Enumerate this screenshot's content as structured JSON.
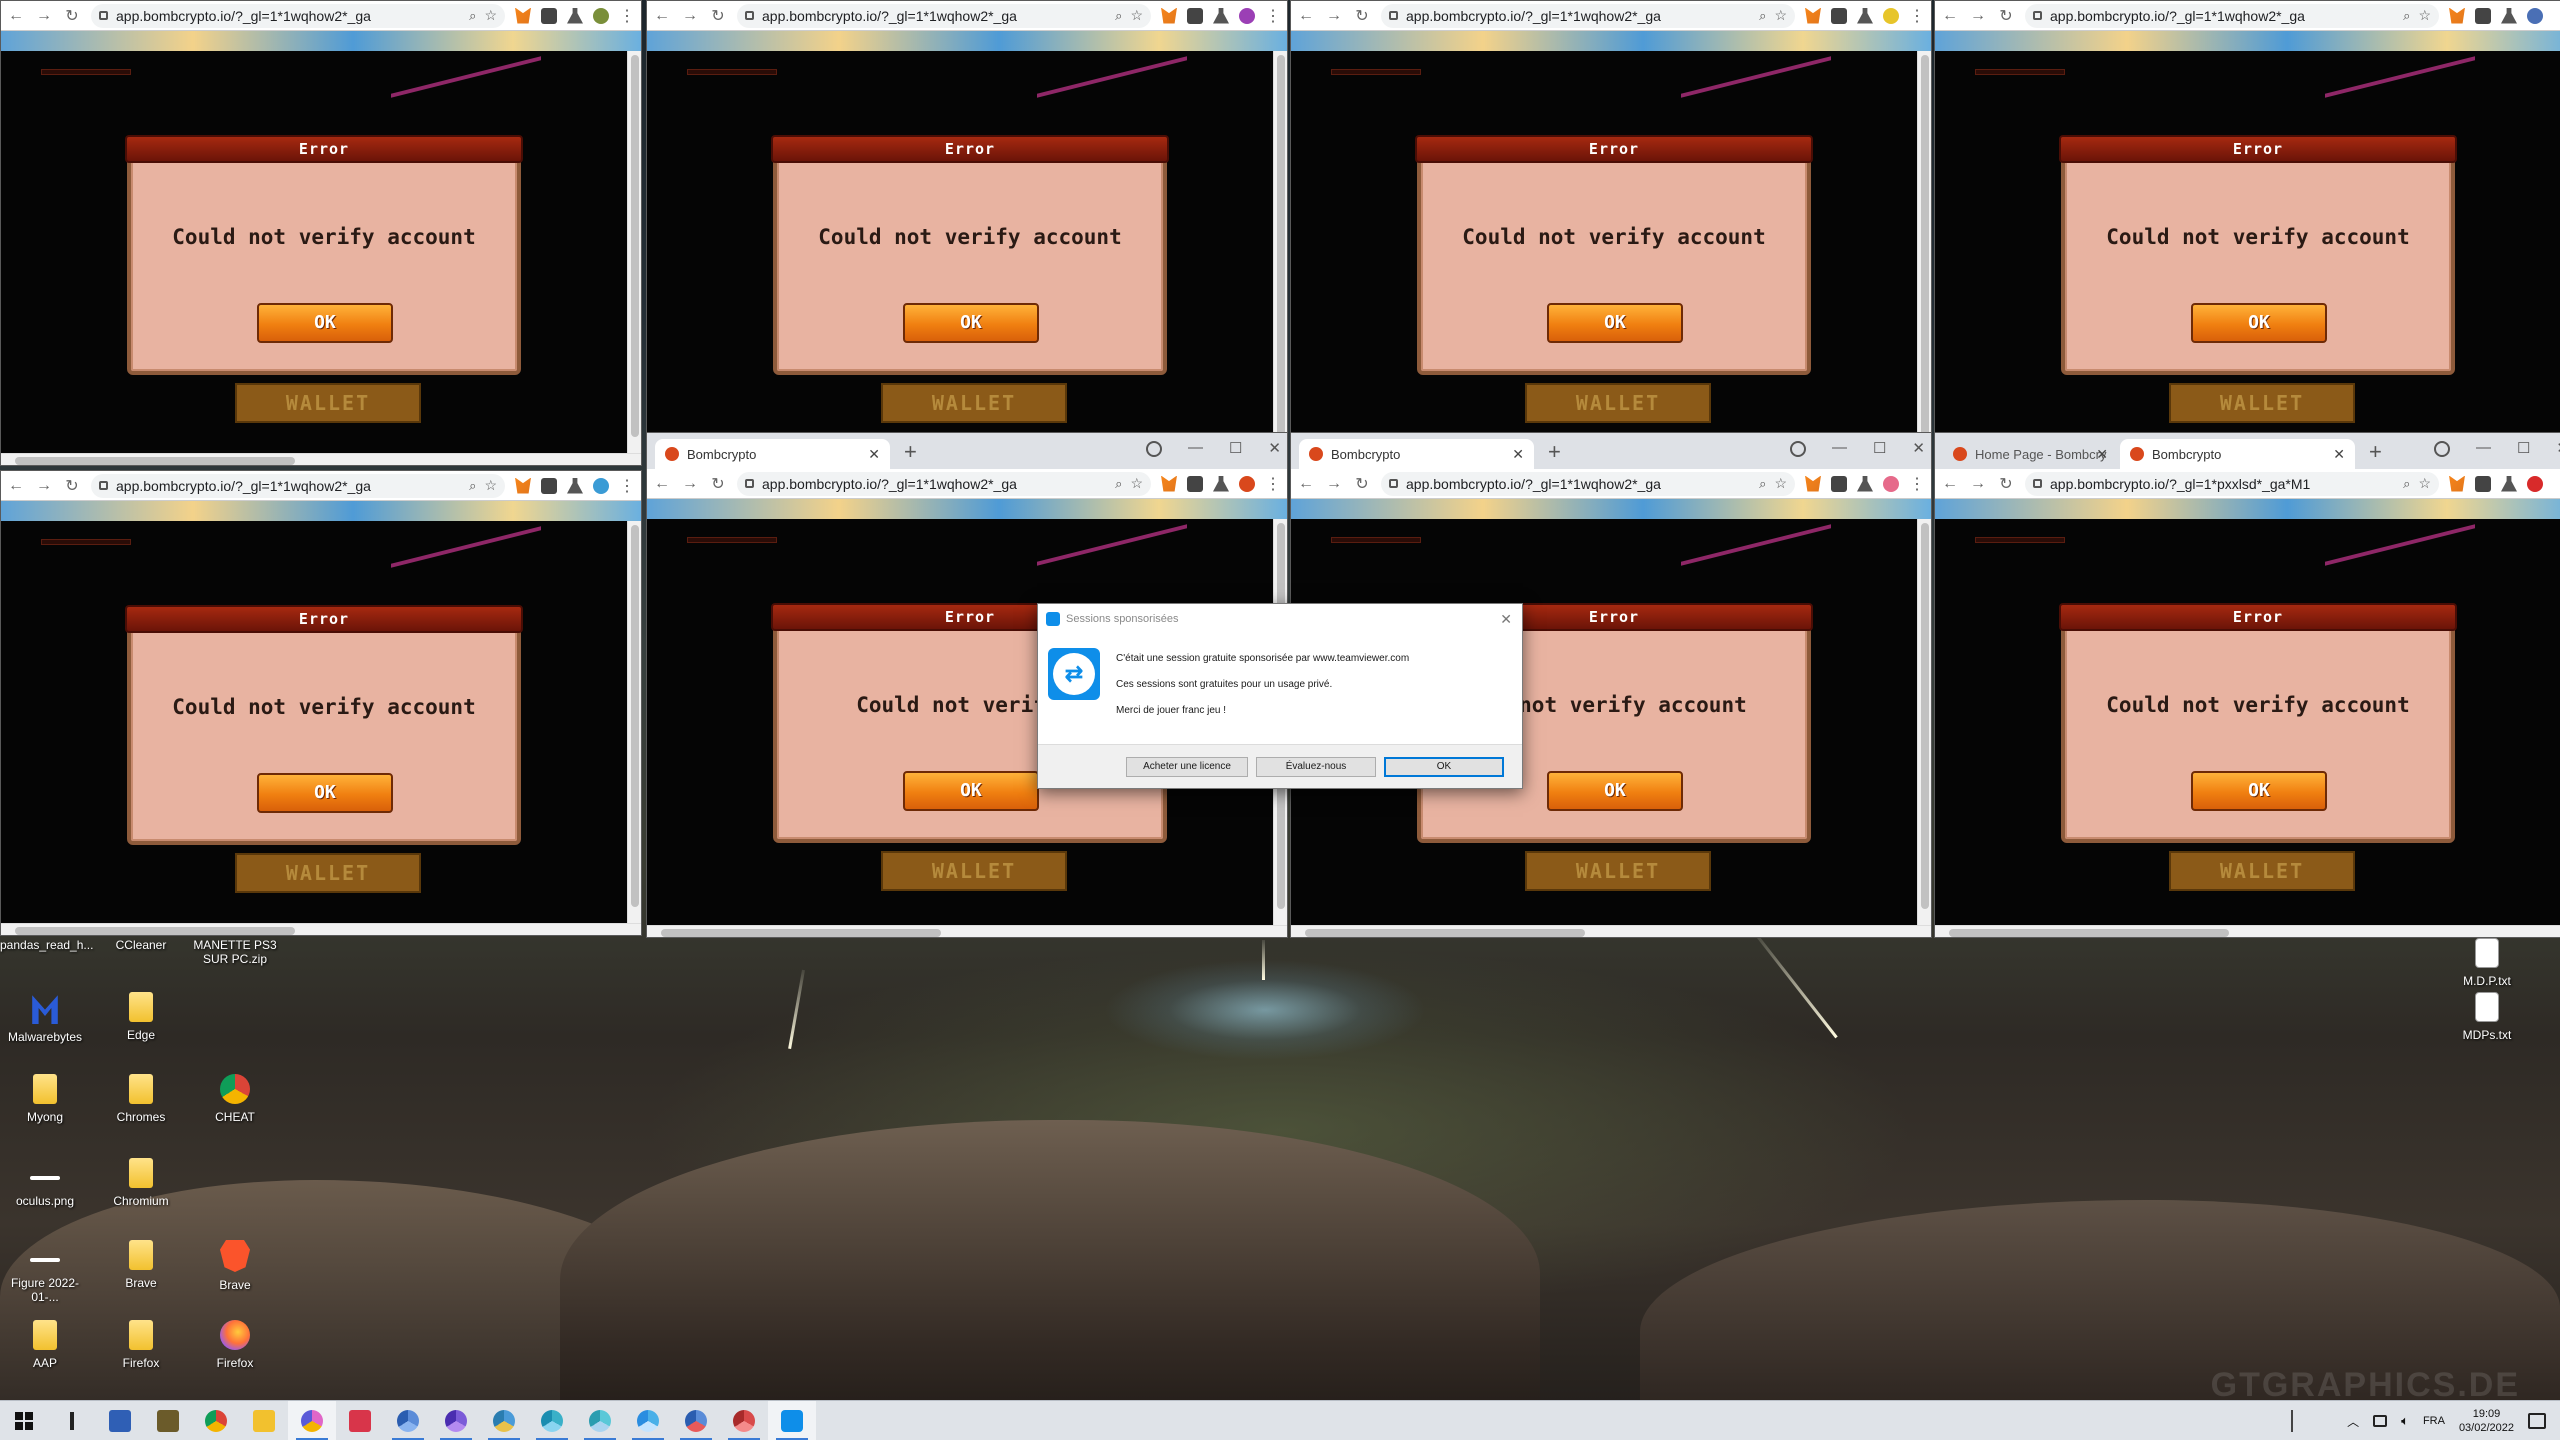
{
  "windows": [
    {
      "id": "w1",
      "url": "app.bombcrypto.io/?_gl=1*1wqhow2*_ga",
      "has_tabs": false,
      "title": "Error",
      "message": "Could not verify account",
      "ok": "OK",
      "wallet": "WALLET",
      "avatar_color": "#7a8f3a"
    },
    {
      "id": "w2",
      "url": "app.bombcrypto.io/?_gl=1*1wqhow2*_ga",
      "has_tabs": false,
      "title": "Error",
      "message": "Could not verify account",
      "ok": "OK",
      "wallet": "WALLET",
      "avatar_color": "#9b3fb5"
    },
    {
      "id": "w3",
      "url": "app.bombcrypto.io/?_gl=1*1wqhow2*_ga",
      "has_tabs": false,
      "title": "Error",
      "message": "Could not verify account",
      "ok": "OK",
      "wallet": "WALLET",
      "avatar_color": "#e7c52a"
    },
    {
      "id": "w4",
      "url": "app.bombcrypto.io/?_gl=1*1wqhow2*_ga",
      "has_tabs": false,
      "title": "Error",
      "message": "Could not verify account",
      "ok": "OK",
      "wallet": "WALLET",
      "avatar_color": "#4a6fb5"
    },
    {
      "id": "w5",
      "url": "app.bombcrypto.io/?_gl=1*1wqhow2*_ga",
      "has_tabs": false,
      "title": "Error",
      "message": "Could not verify account",
      "ok": "OK",
      "wallet": "WALLET",
      "avatar_color": "#3a9bd5"
    },
    {
      "id": "w6",
      "url": "app.bombcrypto.io/?_gl=1*1wqhow2*_ga",
      "has_tabs": true,
      "tabs": [
        "Bombcrypto"
      ],
      "title": "Error",
      "message": "Could not verify a",
      "ok": "OK",
      "wallet": "WALLET",
      "avatar_color": "#d9481c"
    },
    {
      "id": "w7",
      "url": "app.bombcrypto.io/?_gl=1*1wqhow2*_ga",
      "has_tabs": true,
      "tabs": [
        "Bombcrypto"
      ],
      "title": "Error",
      "message": "ld not verify account",
      "ok": "OK",
      "wallet": "WALLET",
      "avatar_color": "#e66a8a"
    },
    {
      "id": "w8",
      "url": "app.bombcrypto.io/?_gl=1*pxxlsd*_ga*M1",
      "has_tabs": true,
      "tabs": [
        "Home Page - Bombcry",
        "Bombcrypto"
      ],
      "title": "Error",
      "message": "Could not verify account",
      "ok": "OK",
      "wallet": "WALLET",
      "avatar_color": "#d82a2a"
    }
  ],
  "teamviewer": {
    "title": "Sessions sponsorisées",
    "line1": "C'était une session gratuite sponsorisée par www.teamviewer.com",
    "line2": "Ces sessions sont gratuites pour un usage privé.",
    "line3": "Merci de jouer franc jeu !",
    "btn_license": "Acheter une licence",
    "btn_rate": "Évaluez-nous",
    "btn_ok": "OK"
  },
  "desktop_icons": [
    {
      "label": "pandas_read_h...",
      "icon": "file-icon"
    },
    {
      "label": "CCleaner",
      "icon": "ccleaner-icon"
    },
    {
      "label": "MANETTE PS3 SUR PC.zip",
      "icon": "zip-icon"
    },
    {
      "label": "Malwarebytes",
      "icon": "malwarebytes-icon"
    },
    {
      "label": "Edge",
      "icon": "folder-icon"
    },
    {
      "label": "Myong",
      "icon": "folder-icon"
    },
    {
      "label": "Chromes",
      "icon": "folder-icon"
    },
    {
      "label": "CHEAT",
      "icon": "chrome-icon"
    },
    {
      "label": "oculus.png",
      "icon": "image-icon"
    },
    {
      "label": "Chromium",
      "icon": "folder-icon"
    },
    {
      "label": "Figure 2022-01-...",
      "icon": "image-icon"
    },
    {
      "label": "Brave",
      "icon": "folder-icon"
    },
    {
      "label": "Brave",
      "icon": "brave-icon"
    },
    {
      "label": "AAP",
      "icon": "folder-icon"
    },
    {
      "label": "Firefox",
      "icon": "folder-icon"
    },
    {
      "label": "Firefox",
      "icon": "firefox-icon"
    },
    {
      "label": "M.D.P.txt",
      "icon": "file-icon"
    },
    {
      "label": "MDPs.txt",
      "icon": "file-icon"
    }
  ],
  "taskbar": {
    "language": "FRA",
    "time": "19:09",
    "date": "03/02/2022"
  },
  "watermark": "GTGRAPHICS.DE"
}
